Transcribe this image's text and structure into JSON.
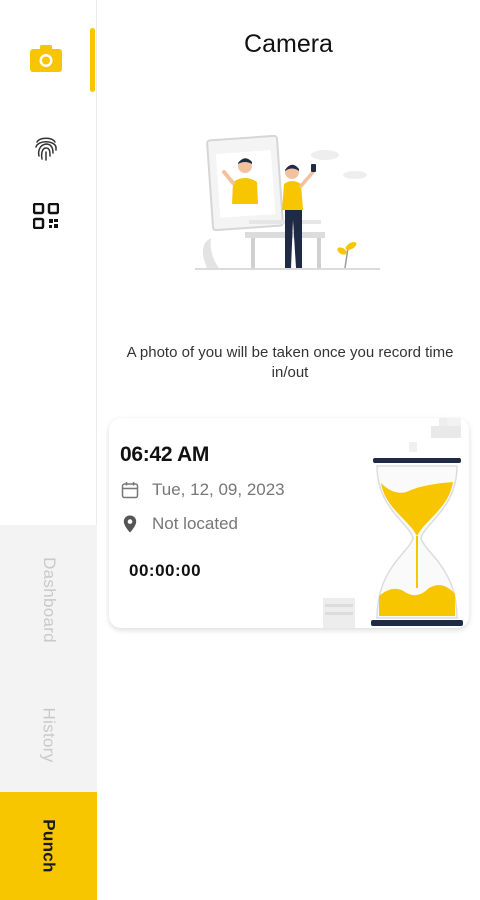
{
  "header": {
    "title": "Camera"
  },
  "rail": {
    "icons": [
      "camera-icon",
      "fingerprint-icon",
      "qr-code-icon"
    ],
    "tabs": {
      "dashboard": "Dashboard",
      "history": "History",
      "punch": "Punch"
    }
  },
  "info": {
    "text": "A photo of you will be taken once you record time in/out"
  },
  "card": {
    "time": "06:42 AM",
    "date": "Tue, 12, 09, 2023",
    "location": "Not located",
    "timer": "00:00:00"
  },
  "colors": {
    "accent": "#f7c600",
    "text": "#1a1a1a",
    "muted": "#777777",
    "rail_bg": "#f3f3f3"
  }
}
